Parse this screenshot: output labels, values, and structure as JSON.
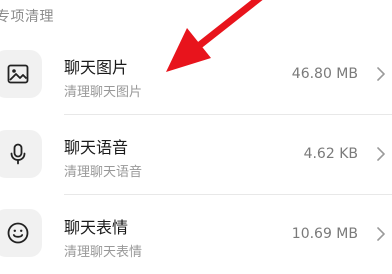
{
  "section": {
    "header": "专项清理"
  },
  "items": [
    {
      "title": "聊天图片",
      "subtitle": "清理聊天图片",
      "size": "46.80 MB",
      "icon": "image-icon"
    },
    {
      "title": "聊天语音",
      "subtitle": "清理聊天语音",
      "size": "4.62 KB",
      "icon": "microphone-icon"
    },
    {
      "title": "聊天表情",
      "subtitle": "清理聊天表情",
      "size": "10.69 MB",
      "icon": "smiley-icon"
    }
  ],
  "colors": {
    "annotation_arrow": "#e8141c",
    "icon_tile_bg": "#f1f1f1",
    "title_text": "#1a1a1a",
    "secondary_text": "#999999"
  }
}
